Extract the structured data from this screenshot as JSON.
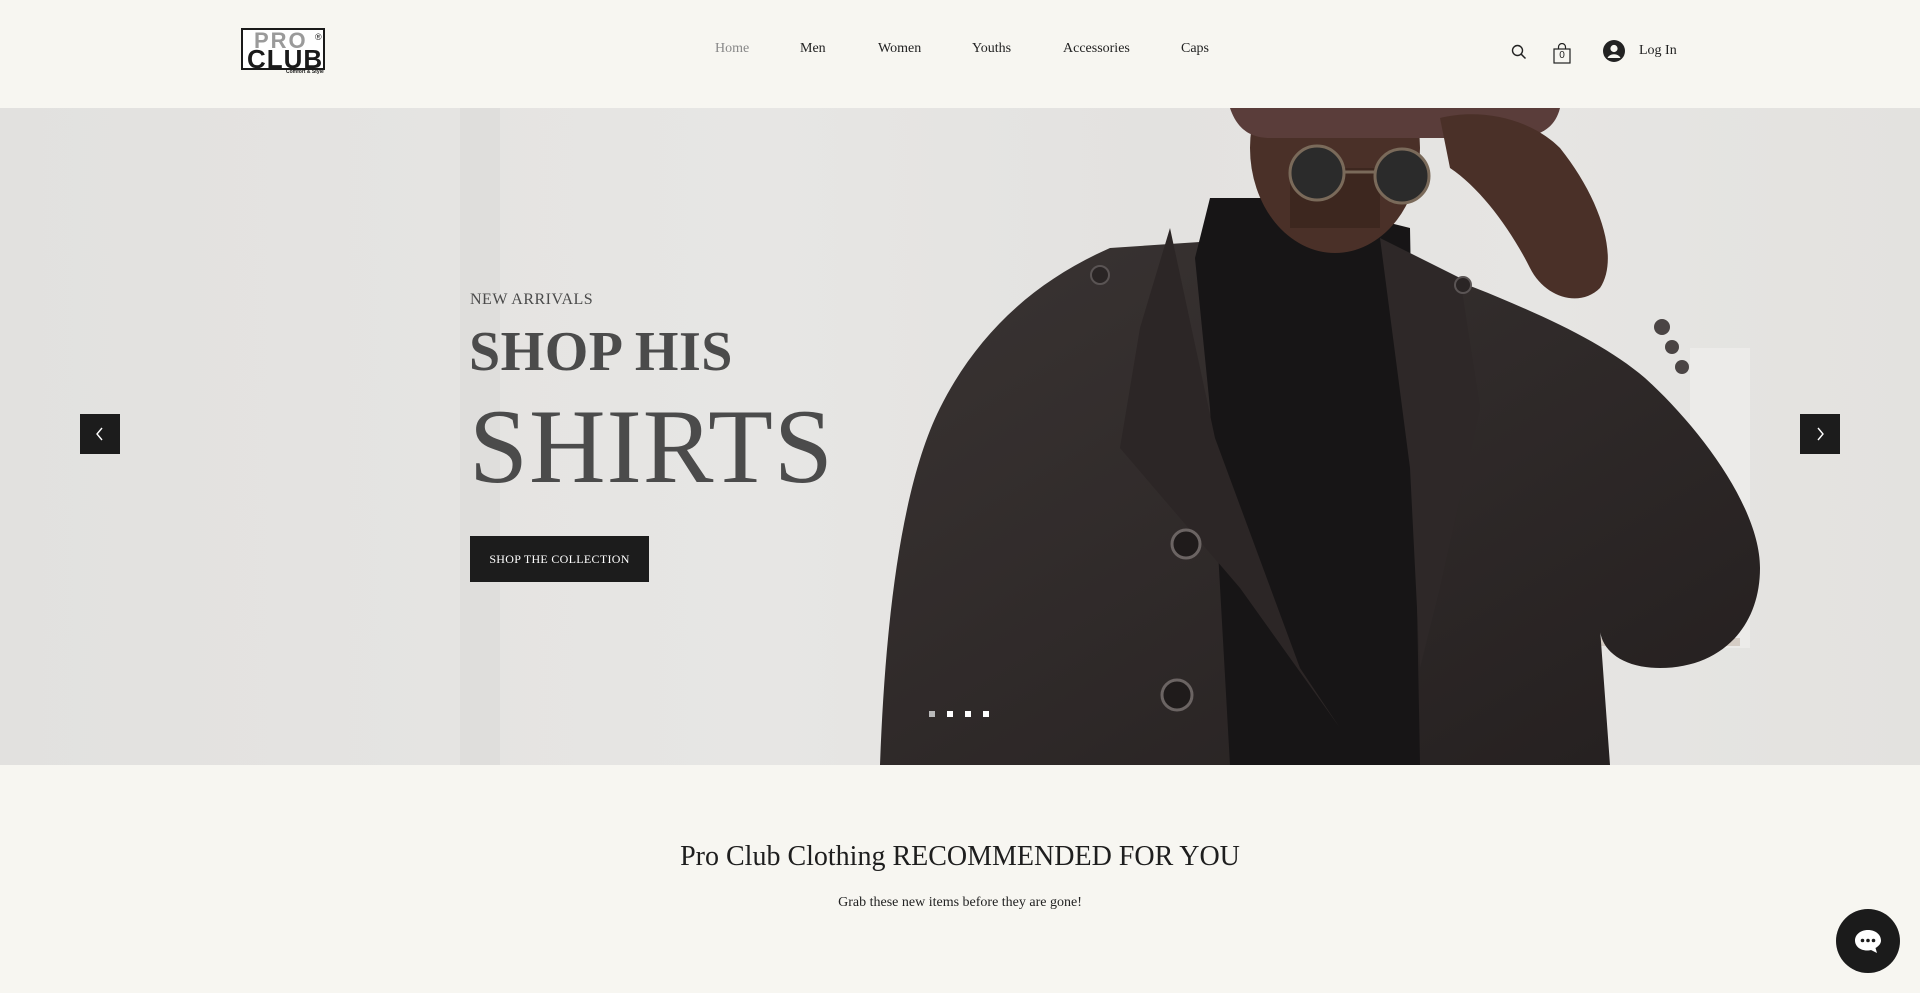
{
  "brand": {
    "logo_top": "PRO",
    "logo_bottom": "CLUB",
    "logo_reg": "®",
    "logo_tagline": "Comfort & Style"
  },
  "nav": {
    "items": [
      {
        "label": "Home",
        "active": true
      },
      {
        "label": "Men",
        "active": false
      },
      {
        "label": "Women",
        "active": false
      },
      {
        "label": "Youths",
        "active": false
      },
      {
        "label": "Accessories",
        "active": false
      },
      {
        "label": "Caps",
        "active": false
      }
    ]
  },
  "header": {
    "search_icon": "search-icon",
    "cart_icon": "shopping-bag-icon",
    "cart_count": "0",
    "avatar_icon": "user-avatar-icon",
    "login_label": "Log In"
  },
  "hero": {
    "eyebrow": "NEW ARRIVALS",
    "headline_1": "SHOP HIS",
    "headline_2": "SHIRTS",
    "cta_label": "SHOP THE COLLECTION",
    "prev_icon": "chevron-left-icon",
    "next_icon": "chevron-right-icon",
    "slide_count": 4,
    "active_slide": 1
  },
  "recommended": {
    "title": "Pro Club Clothing RECOMMENDED FOR YOU",
    "subtitle": "Grab these new items before they are gone!"
  },
  "chat": {
    "icon": "chat-bubble-icon"
  },
  "colors": {
    "background": "#f7f6f1",
    "dark": "#1c1c1c",
    "headline": "#4b4b4b",
    "nav_active": "#888888"
  }
}
